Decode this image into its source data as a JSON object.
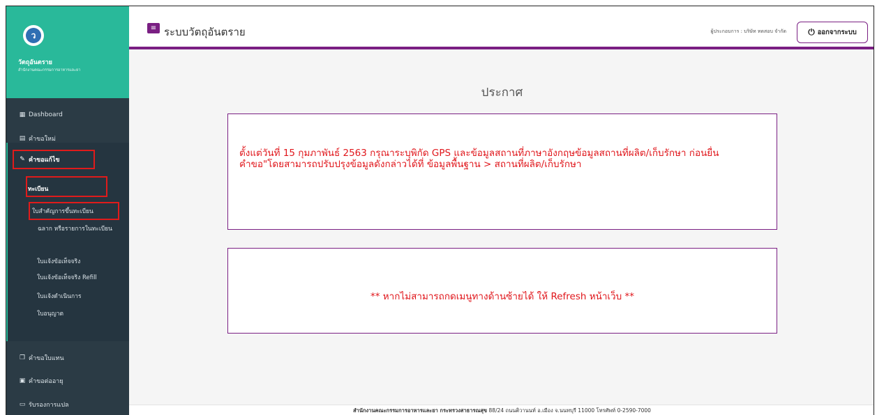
{
  "brand": {
    "logo_text": "ว",
    "name": "วัตถุอันตราย",
    "subtitle": "สำนักงานคณะกรรมการอาหารและยา"
  },
  "sidebar": {
    "items": [
      {
        "label": "Dashboard",
        "icon": "grid-icon"
      },
      {
        "label": "คำขอใหม่",
        "icon": "document-icon"
      },
      {
        "label": "คำขอแก้ไข",
        "icon": "edit-icon"
      },
      {
        "label": "คำขอใบแทน",
        "icon": "copy-icon"
      },
      {
        "label": "คำขอต่ออายุ",
        "icon": "calendar-icon"
      },
      {
        "label": "รับรองการแปล",
        "icon": "translate-icon"
      }
    ],
    "sub_items": [
      {
        "label": "ทะเบียน"
      },
      {
        "label": "ใบสำคัญการขึ้นทะเบียน"
      },
      {
        "label": "ฉลาก หรือรายการในทะเบียน"
      },
      {
        "label": "ใบแจ้งข้อเท็จจริง"
      },
      {
        "label": "ใบแจ้งข้อเท็จจริง Refill"
      },
      {
        "label": "ใบแจ้งดำเนินการ"
      },
      {
        "label": "ใบอนุญาต"
      }
    ]
  },
  "header": {
    "menu_icon": "≡",
    "title": "ระบบวัตถุอันตราย",
    "operator": "ผู้ประกอบการ : บริษัท ทดสอบ จำกัด",
    "logout_label": "ออกจากระบบ",
    "logout_icon": "⏻",
    "accent_color": "#7a1f83"
  },
  "main": {
    "page_title": "ประกาศ",
    "announcement": "ตั้งแต่วันที่ 15 กุมภาพันธ์ 2563 กรุณาระบุพิกัด GPS และข้อมูลสถานที่ภาษาอังกฤษข้อมูลสถานที่ผลิต/เก็บรักษา ก่อนยื่นคำขอ\"โดยสามารถปรับปรุงข้อมูลดังกล่าวได้ที่ ข้อมูลพื้นฐาน > สถานที่ผลิต/เก็บรักษา",
    "notice": "** หากไม่สามารถกดเมนูทางด้านซ้ายได้ ให้ Refresh หน้าเว็บ **",
    "text_color": "#e0161b"
  },
  "footer": {
    "org": "สำนักงานคณะกรรมการอาหารและยา กระทรวงสาธารณสุข",
    "address": "88/24 ถนนติวานนท์ อ.เมือง จ.นนทบุรี 11000 โทรศัพท์ 0-2590-7000"
  }
}
